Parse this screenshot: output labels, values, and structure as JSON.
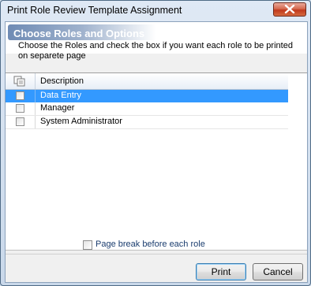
{
  "window": {
    "title": "Print Role Review Template Assignment"
  },
  "header": {
    "section_title": "Choose Roles and Options",
    "instructions": "Choose the Roles and check the box if you want each role to be printed on separete page"
  },
  "grid": {
    "column_header": "Description",
    "rows": [
      {
        "label": "Data Entry",
        "checked": false,
        "selected": true
      },
      {
        "label": "Manager",
        "checked": false,
        "selected": false
      },
      {
        "label": "System Administrator",
        "checked": false,
        "selected": false
      }
    ]
  },
  "options": {
    "page_break_label": "Page break before each role",
    "page_break_checked": false
  },
  "buttons": {
    "print_label": "Print",
    "cancel_label": "Cancel"
  },
  "colors": {
    "selection": "#3399ff",
    "section_title": "#ffffff"
  }
}
